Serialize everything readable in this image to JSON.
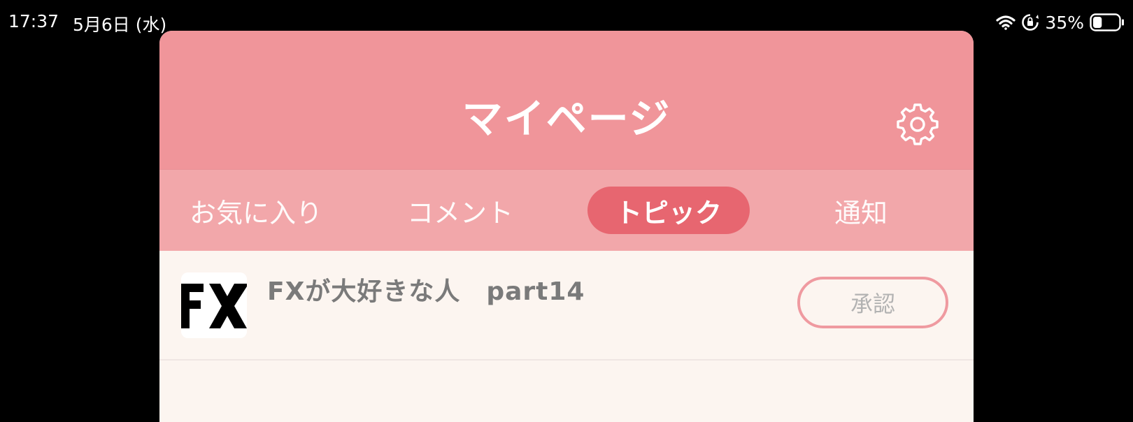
{
  "status_bar": {
    "time": "17:37",
    "date": "5月6日 (水)",
    "battery_percent": "35%",
    "icons": [
      "wifi-icon",
      "orientation-lock-icon",
      "battery-icon"
    ],
    "battery_level": 0.35
  },
  "header": {
    "title": "マイページ",
    "settings_icon": "gear-icon"
  },
  "tabs": [
    {
      "label": "お気に入り",
      "selected": false
    },
    {
      "label": "コメント",
      "selected": false
    },
    {
      "label": "トピック",
      "selected": true
    },
    {
      "label": "通知",
      "selected": false
    }
  ],
  "topics": [
    {
      "thumbnail_text": "FX",
      "title": "FXが大好きな人　part14",
      "action_label": "承認"
    }
  ],
  "colors": {
    "header_bg": "#f0959a",
    "tabs_bg": "#f2a7aa",
    "active_tab_bg": "#e76670",
    "content_bg": "#fcf5f0",
    "button_border": "#ef9aa0"
  }
}
